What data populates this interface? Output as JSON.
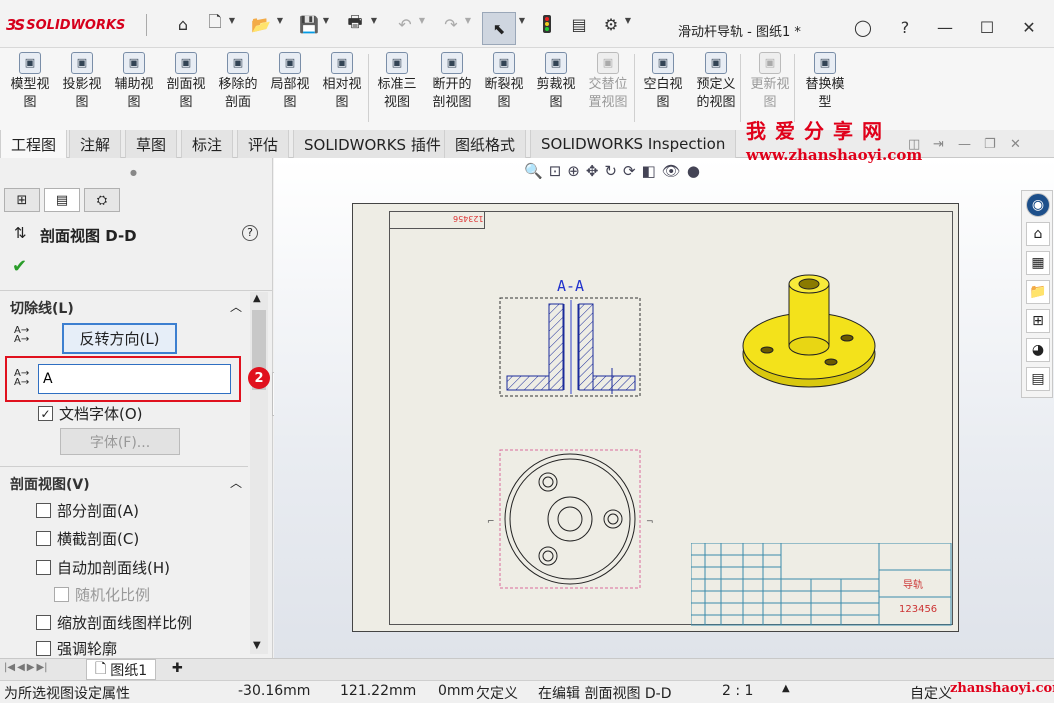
{
  "app": {
    "brand": "SOLIDWORKS",
    "brand_ds": "3S",
    "doc_title": "滑动杆导轨 - 图纸1 *"
  },
  "ribbon": {
    "buttons": [
      {
        "l1": "模型视",
        "l2": "图",
        "icon": "model-view-icon"
      },
      {
        "l1": "投影视",
        "l2": "图",
        "icon": "projected-view-icon"
      },
      {
        "l1": "辅助视",
        "l2": "图",
        "icon": "auxiliary-view-icon"
      },
      {
        "l1": "剖面视",
        "l2": "图",
        "icon": "section-view-icon"
      },
      {
        "l1": "移除的",
        "l2": "剖面",
        "icon": "removed-section-icon"
      },
      {
        "l1": "局部视",
        "l2": "图",
        "icon": "detail-view-icon"
      },
      {
        "l1": "相对视",
        "l2": "图",
        "icon": "relative-view-icon"
      },
      {
        "l1": "标准三",
        "l2": "视图",
        "icon": "standard-3view-icon"
      },
      {
        "l1": "断开的",
        "l2": "剖视图",
        "icon": "broken-out-section-icon"
      },
      {
        "l1": "断裂视",
        "l2": "图",
        "icon": "break-view-icon"
      },
      {
        "l1": "剪裁视",
        "l2": "图",
        "icon": "crop-view-icon"
      },
      {
        "l1": "交替位",
        "l2": "置视图",
        "icon": "alternate-position-icon",
        "disabled": true
      },
      {
        "l1": "空白视",
        "l2": "图",
        "icon": "empty-view-icon"
      },
      {
        "l1": "预定义",
        "l2": "的视图",
        "icon": "predefined-view-icon"
      },
      {
        "l1": "更新视",
        "l2": "图",
        "icon": "update-view-icon",
        "disabled": true
      },
      {
        "l1": "替换模",
        "l2": "型",
        "icon": "replace-model-icon"
      }
    ]
  },
  "tabs": [
    "工程图",
    "注解",
    "草图",
    "标注",
    "评估",
    "SOLIDWORKS 插件",
    "图纸格式",
    "SOLIDWORKS Inspection"
  ],
  "watermark": {
    "text": "我爱分享网",
    "url": "www.zhanshaoyi.com"
  },
  "panel": {
    "title": "剖面视图 D-D",
    "cut_line": {
      "header": "切除线(L)",
      "flip_button": "反转方向(L)",
      "label_value": "A",
      "doc_font": "文档字体(O)",
      "font_button": "字体(F)..."
    },
    "section_view": {
      "header": "剖面视图(V)",
      "options": [
        {
          "label": "部分剖面(A)",
          "checked": false,
          "disabled": false
        },
        {
          "label": "横截剖面(C)",
          "checked": false,
          "disabled": false
        },
        {
          "label": "自动加剖面线(H)",
          "checked": false,
          "disabled": false
        },
        {
          "label": "随机化比例",
          "checked": false,
          "disabled": true
        },
        {
          "label": "缩放剖面线图样比例",
          "checked": false,
          "disabled": false
        },
        {
          "label": "强调轮廓",
          "checked": false,
          "disabled": false
        }
      ]
    },
    "callout_badge": "2"
  },
  "drawing": {
    "section_label": "A-A",
    "stamp_text": "123456",
    "title_block_name": "导轨",
    "title_block_number": "123456"
  },
  "sheet_tab": "图纸1",
  "status": {
    "message": "为所选视图设定属性",
    "x": "-30.16mm",
    "y": "121.22mm",
    "z": "0mm",
    "defined": "欠定义",
    "editing": "在编辑 剖面视图 D-D",
    "scale": "2 : 1",
    "units": "自定义",
    "footer_watermark": "zhanshaoyi.com"
  },
  "colors": {
    "accent_red": "#e0001a",
    "selection_blue": "#0033cc",
    "part_yellow": "#f3e21b"
  }
}
